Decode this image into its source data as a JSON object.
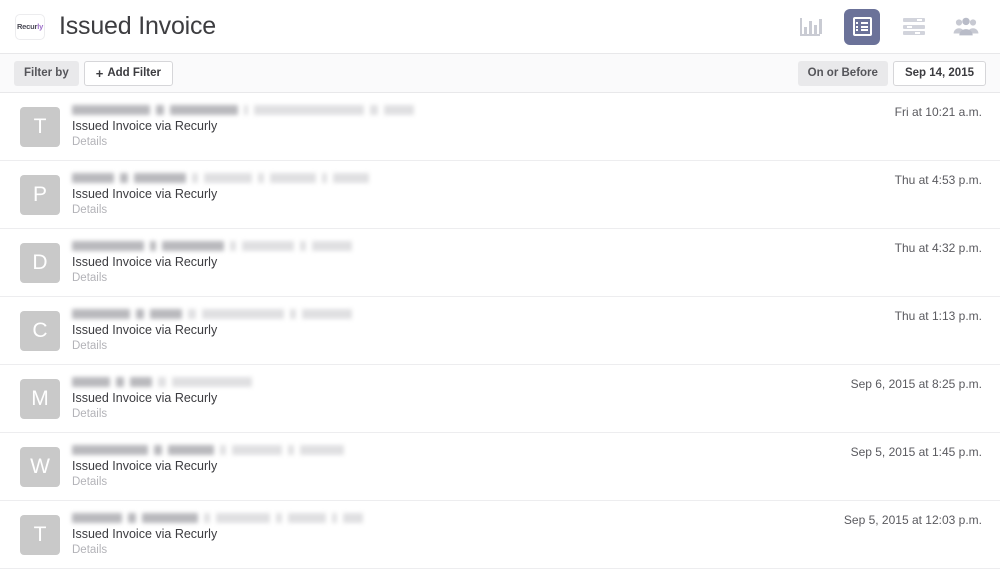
{
  "header": {
    "logo_text_main": "Recur",
    "logo_text_accent": "ly",
    "logo_name": "Recurly",
    "title": "Issued Invoice",
    "icons": [
      {
        "name": "bar-chart-icon",
        "label": "Analytics",
        "active": false
      },
      {
        "name": "list-icon",
        "label": "Activity List",
        "active": true
      },
      {
        "name": "sliders-icon",
        "label": "Streams",
        "active": false
      },
      {
        "name": "people-icon",
        "label": "People",
        "active": false
      }
    ],
    "active_icon_bg": "#6b7299"
  },
  "filter_bar": {
    "filter_by_label": "Filter by",
    "add_filter_label": "Add Filter",
    "add_filter_plus": "+",
    "date_operator_label": "On or Before",
    "date_value": "Sep 14, 2015"
  },
  "list": {
    "action_text": "Issued Invoice via Recurly",
    "details_label": "Details",
    "rows": [
      {
        "avatar_letter": "T",
        "action": "Issued Invoice via Recurly",
        "details": "Details",
        "time": "Fri at 10:21 a.m.",
        "redacted_widths": [
          78,
          8,
          68,
          4,
          110,
          8,
          30
        ]
      },
      {
        "avatar_letter": "P",
        "action": "Issued Invoice via Recurly",
        "details": "Details",
        "time": "Thu at 4:53 p.m.",
        "redacted_widths": [
          42,
          8,
          52,
          6,
          48,
          6,
          46,
          5,
          36
        ]
      },
      {
        "avatar_letter": "D",
        "action": "Issued Invoice via Recurly",
        "details": "Details",
        "time": "Thu at 4:32 p.m.",
        "redacted_widths": [
          72,
          6,
          62,
          6,
          52,
          6,
          40
        ]
      },
      {
        "avatar_letter": "C",
        "action": "Issued Invoice via Recurly",
        "details": "Details",
        "time": "Thu at 1:13 p.m.",
        "redacted_widths": [
          58,
          8,
          32,
          8,
          82,
          6,
          50
        ]
      },
      {
        "avatar_letter": "M",
        "action": "Issued Invoice via Recurly",
        "details": "Details",
        "time": "Sep 6, 2015 at 8:25 p.m.",
        "redacted_widths": [
          38,
          8,
          22,
          8,
          80
        ]
      },
      {
        "avatar_letter": "W",
        "action": "Issued Invoice via Recurly",
        "details": "Details",
        "time": "Sep 5, 2015 at 1:45 p.m.",
        "redacted_widths": [
          76,
          8,
          46,
          6,
          50,
          6,
          44
        ]
      },
      {
        "avatar_letter": "T",
        "action": "Issued Invoice via Recurly",
        "details": "Details",
        "time": "Sep 5, 2015 at 12:03 p.m.",
        "redacted_widths": [
          50,
          8,
          56,
          6,
          54,
          6,
          38,
          5,
          20
        ]
      }
    ]
  }
}
